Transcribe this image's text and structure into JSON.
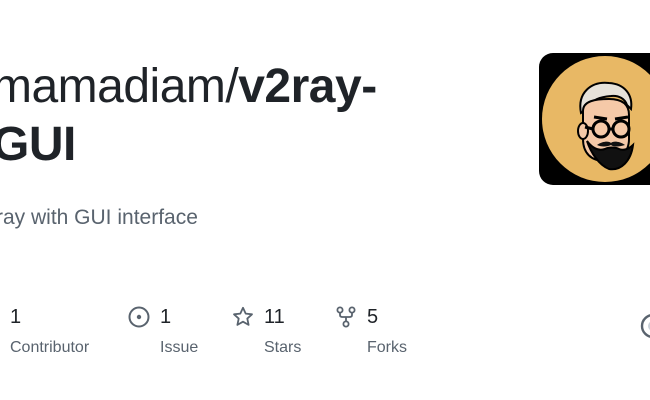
{
  "repo": {
    "owner": "mamadiam/",
    "name_line1": "v2ray-",
    "name_line2": "GUI",
    "description": "ray with GUI interface"
  },
  "avatar": {
    "icon": "user-avatar-cartoon",
    "background": "#e8b865"
  },
  "stats": [
    {
      "icon": "contributors-icon",
      "count": "1",
      "label": "Contributor"
    },
    {
      "icon": "issue-icon",
      "count": "1",
      "label": "Issue"
    },
    {
      "icon": "star-icon",
      "count": "11",
      "label": "Stars"
    },
    {
      "icon": "fork-icon",
      "count": "5",
      "label": "Forks"
    }
  ],
  "colors": {
    "text": "#1f2328",
    "muted": "#59636e"
  }
}
